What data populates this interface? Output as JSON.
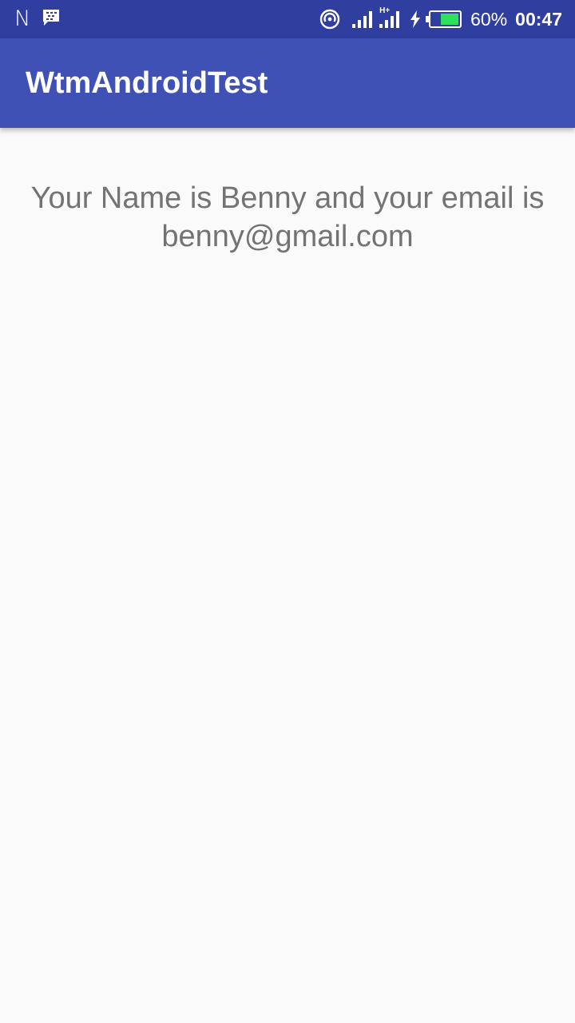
{
  "status_bar": {
    "left_icons": [
      "n-letter-icon",
      "bbm-chat-icon"
    ],
    "n_glyph": "N",
    "network_badge": "H+",
    "battery_percent": "60%",
    "battery_level": 0.6,
    "clock": "00:47",
    "background_color": "#303f9f"
  },
  "app_bar": {
    "title": "WtmAndroidTest",
    "background_color": "#3f51b5"
  },
  "main": {
    "message": "Your Name is Benny and your email is benny@gmail.com"
  }
}
